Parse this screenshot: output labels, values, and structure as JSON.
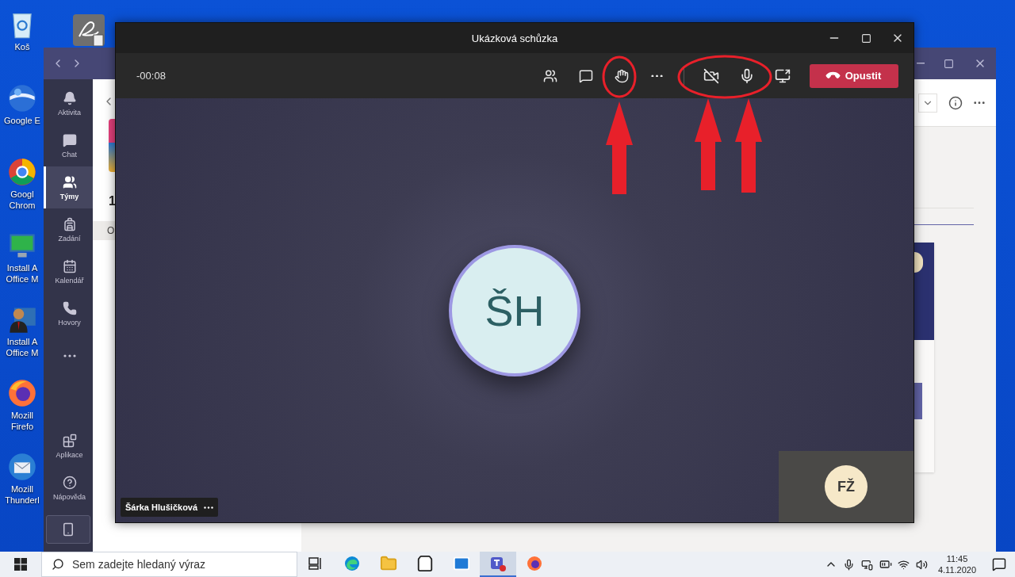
{
  "desktop": {
    "icons": [
      {
        "kind": "trash",
        "lines": [
          "Koš"
        ]
      },
      {
        "kind": "globe",
        "lines": [
          "Google E"
        ]
      },
      {
        "kind": "browser",
        "lines": [
          "Googl",
          "Chrom"
        ]
      },
      {
        "kind": "installer",
        "lines": [
          "Install A",
          "Office M"
        ]
      },
      {
        "kind": "installer-person",
        "lines": [
          "Install A",
          "Office M"
        ]
      },
      {
        "kind": "firefox",
        "lines": [
          "Mozill",
          "Firefo"
        ]
      },
      {
        "kind": "thunderbird",
        "lines": [
          "Mozill",
          "Thunderl"
        ]
      }
    ]
  },
  "teams_window": {
    "rail": {
      "items": [
        {
          "kind": "bell",
          "label": "Aktivita",
          "selected": false
        },
        {
          "kind": "chat",
          "label": "Chat",
          "selected": false
        },
        {
          "kind": "teams",
          "label": "Týmy",
          "selected": true
        },
        {
          "kind": "assignments",
          "label": "Zadání",
          "selected": false
        },
        {
          "kind": "calendar",
          "label": "Kalendář",
          "selected": false
        },
        {
          "kind": "calls",
          "label": "Hovory",
          "selected": false
        }
      ],
      "bottom_items": [
        {
          "kind": "apps",
          "label": "Aplikace"
        },
        {
          "kind": "help",
          "label": "Nápověda"
        }
      ]
    },
    "left_panel": {
      "heading": "1",
      "tab": "O"
    }
  },
  "meeting_window": {
    "title": "Ukázková schůzka",
    "timer": "-00:08",
    "camera_on": false,
    "mic_on": true,
    "leave_label": "Opustit",
    "participant": {
      "initials": "ŠH",
      "name": "Šárka Hlušičková"
    },
    "self_view": {
      "initials": "FŽ"
    }
  },
  "taskbar": {
    "search": {
      "placeholder": "Sem zadejte hledaný výraz"
    },
    "apps": [
      {
        "kind": "task-view",
        "selected": false
      },
      {
        "kind": "edge",
        "selected": false
      },
      {
        "kind": "explorer",
        "selected": false
      },
      {
        "kind": "store",
        "selected": false
      },
      {
        "kind": "mail",
        "selected": false
      },
      {
        "kind": "teams",
        "selected": true
      },
      {
        "kind": "firefox",
        "selected": false
      }
    ],
    "time": "11:45",
    "date": "4.11.2020"
  }
}
